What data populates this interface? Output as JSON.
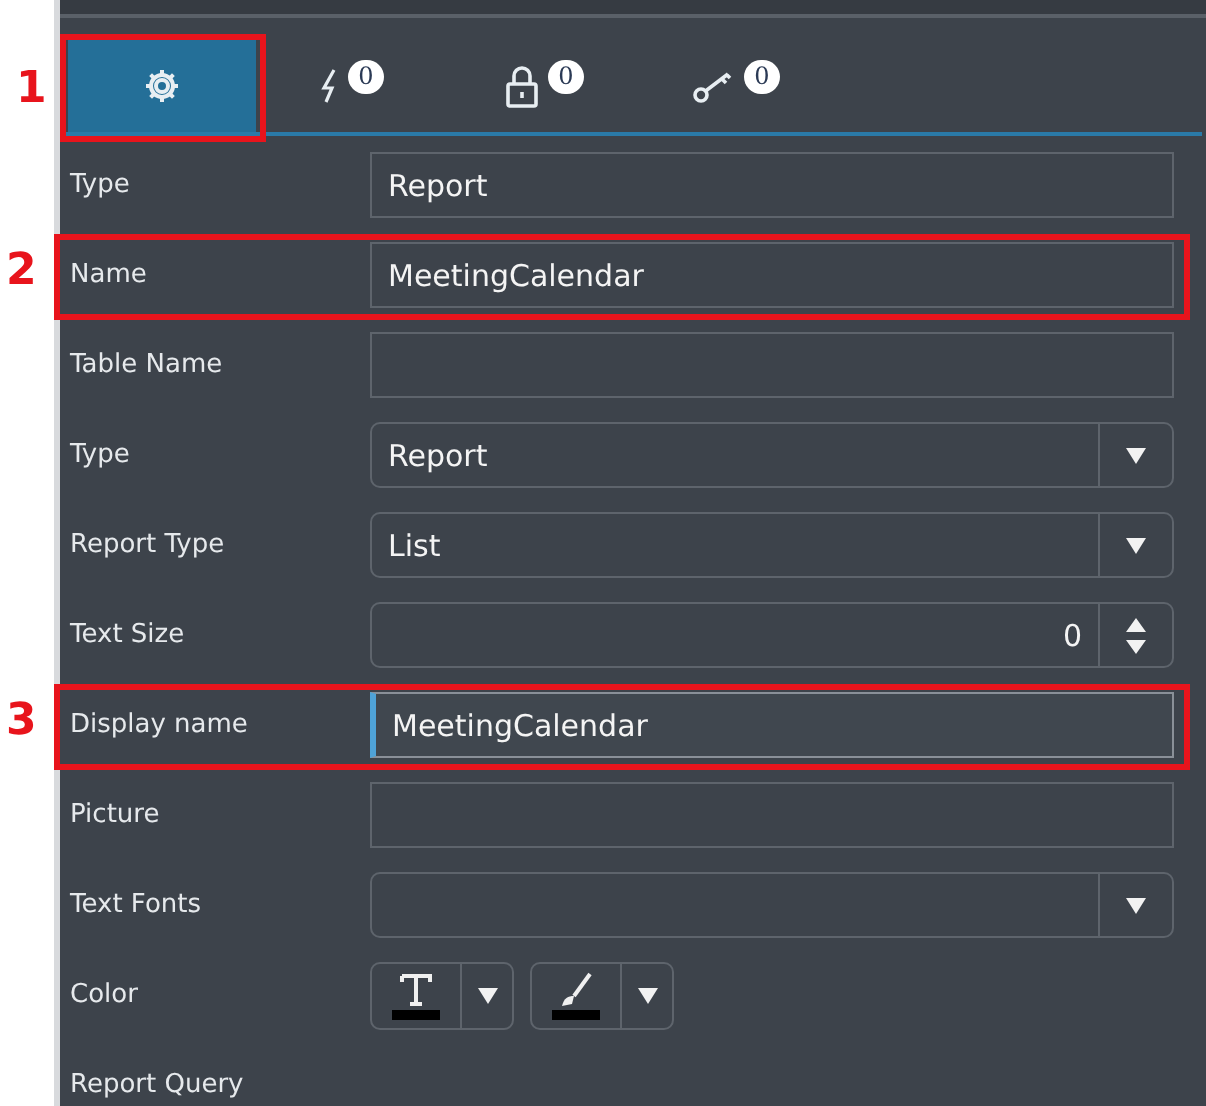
{
  "tabs": [
    {
      "kind": "settings",
      "selected": true,
      "callout": "1"
    },
    {
      "kind": "bolt",
      "badge": "0",
      "selected": false
    },
    {
      "kind": "lock",
      "badge": "0",
      "selected": false
    },
    {
      "kind": "key",
      "badge": "0",
      "selected": false
    }
  ],
  "fields": [
    {
      "label": "Type",
      "kind": "text",
      "value": "Report",
      "focused": false
    },
    {
      "label": "Name",
      "kind": "text",
      "value": "MeetingCalendar",
      "focused": false,
      "callout": "2"
    },
    {
      "label": "Table Name",
      "kind": "text",
      "focused": false
    },
    {
      "label": "Type",
      "kind": "select",
      "value": "Report",
      "focused": false
    },
    {
      "label": "Report Type",
      "kind": "select",
      "value": "List",
      "focused": false
    },
    {
      "label": "Text Size",
      "kind": "number",
      "value": "0",
      "focused": false
    },
    {
      "label": "Display name",
      "kind": "text",
      "value": "MeetingCalendar",
      "focused": true,
      "callout": "3"
    },
    {
      "label": "Picture",
      "kind": "text",
      "focused": false
    },
    {
      "label": "Text Fonts",
      "kind": "select",
      "focused": false
    },
    {
      "label": "Color",
      "kind": "color",
      "swatches": [
        {
          "kind": "text",
          "color": "#000000"
        },
        {
          "kind": "fill",
          "color": "#000000"
        }
      ]
    },
    {
      "label": "Report Query",
      "kind": "heading"
    }
  ]
}
